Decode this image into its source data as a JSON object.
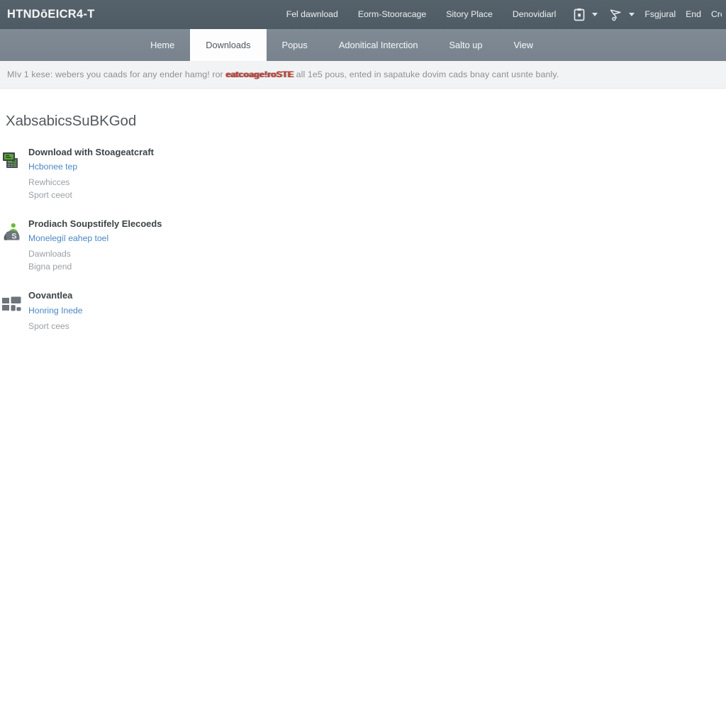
{
  "header": {
    "brand": "HTNDōEICR4-T",
    "links": [
      {
        "label": "Fel dawnload",
        "name": "top-link-free-download"
      },
      {
        "label": "Eorm-Stooracage",
        "name": "top-link-form-storage"
      },
      {
        "label": "Sitory Place",
        "name": "top-link-story-place"
      },
      {
        "label": "Denovidiarl",
        "name": "top-link-download"
      }
    ],
    "icon_menus": [
      {
        "icon": "clipboard-icon",
        "name": "clipboard-menu"
      },
      {
        "icon": "cart-icon",
        "name": "cart-menu"
      }
    ],
    "right_words": [
      {
        "label": "Fsgjural",
        "name": "top-link-regional"
      },
      {
        "label": "End",
        "name": "top-link-end"
      },
      {
        "label": "Cre",
        "name": "top-link-create"
      }
    ]
  },
  "nav": {
    "tabs": [
      {
        "label": "Heme",
        "name": "tab-home",
        "active": false
      },
      {
        "label": "Downloads",
        "name": "tab-downloads",
        "active": true
      },
      {
        "label": "Popus",
        "name": "tab-popups",
        "active": false
      },
      {
        "label": "Adonitical Interction",
        "name": "tab-additional-interaction",
        "active": false
      },
      {
        "label": "Salto up",
        "name": "tab-set-up",
        "active": false
      },
      {
        "label": "View",
        "name": "tab-view",
        "active": false
      }
    ]
  },
  "notice": {
    "prefix": "MIv 1 kese: webers you caads for any ender hamg! ror ",
    "emphasis": "eatcoage!roSTE",
    "suffix": " all 1e5 pous, ented in sapatuke dovim cads bnay cant usnte banly."
  },
  "main": {
    "title": "XabsabicsSuBKGod",
    "cards": [
      {
        "icon": "server-icon",
        "title": "Download with Stoageatcraft",
        "link": "Hcbonee tep",
        "meta": [
          "Rewhicces",
          "Sport ceeot"
        ]
      },
      {
        "icon": "money-person-icon",
        "title": "Prodiach Soupstifely Elecoeds",
        "link": "Monelegiī eahep toel",
        "meta": [
          "Dawnloads",
          "Bigna pend"
        ]
      },
      {
        "icon": "grid-icon",
        "title": "Oovantlea",
        "link": "Honring Inede",
        "meta": [
          "Sport cees"
        ]
      }
    ]
  },
  "colors": {
    "topbar": "#535f68",
    "navbar": "#7c8792",
    "active_tab_bg": "#fdfdfd",
    "notice_bg": "#f2f3f4",
    "emphasis": "#c0392b",
    "link": "#4a87c4",
    "icon_green": "#5ab031",
    "icon_gray": "#6d747b"
  }
}
